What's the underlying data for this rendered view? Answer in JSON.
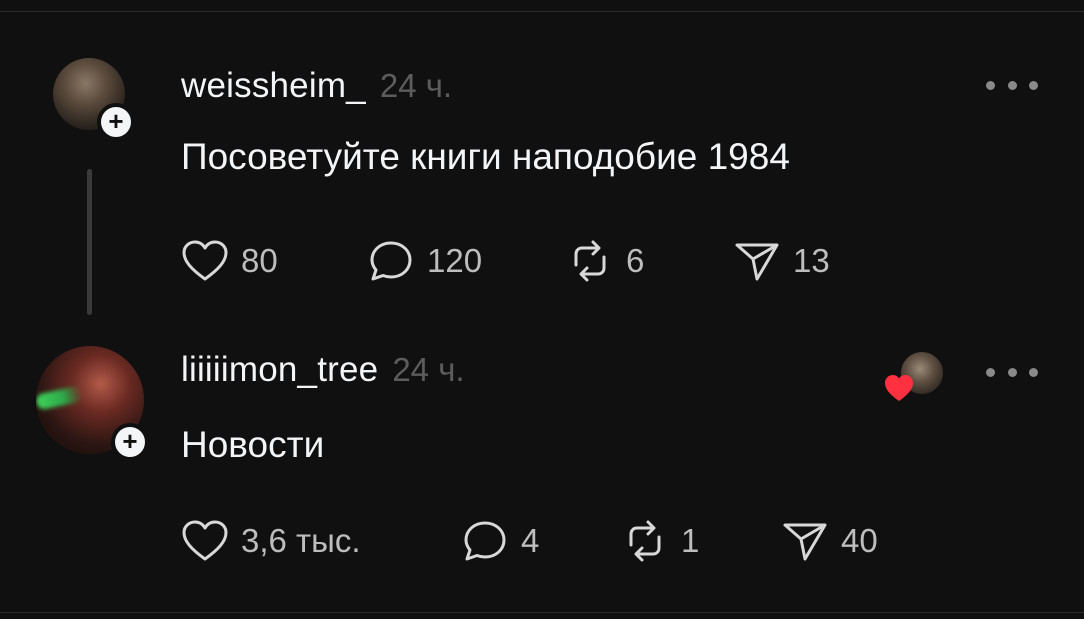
{
  "posts": [
    {
      "username": "weissheim_",
      "timestamp": "24 ч.",
      "text": "Посоветуйте книги наподобие 1984",
      "likes": "80",
      "replies": "120",
      "reposts": "6",
      "shares": "13"
    },
    {
      "username": "liiiiimon_tree",
      "timestamp": "24 ч.",
      "text": "Новости",
      "likes": "3,6 тыс.",
      "replies": "4",
      "reposts": "1",
      "shares": "40"
    }
  ],
  "icons": {
    "follow": "+",
    "heart": "heart-icon",
    "reply": "comment-icon",
    "repost": "repost-icon",
    "share": "send-icon",
    "more": "more-icon"
  },
  "colors": {
    "background": "#101010",
    "text_primary": "#f3f5f7",
    "text_secondary": "#5c5c5c",
    "liked_heart": "#ff3040"
  }
}
